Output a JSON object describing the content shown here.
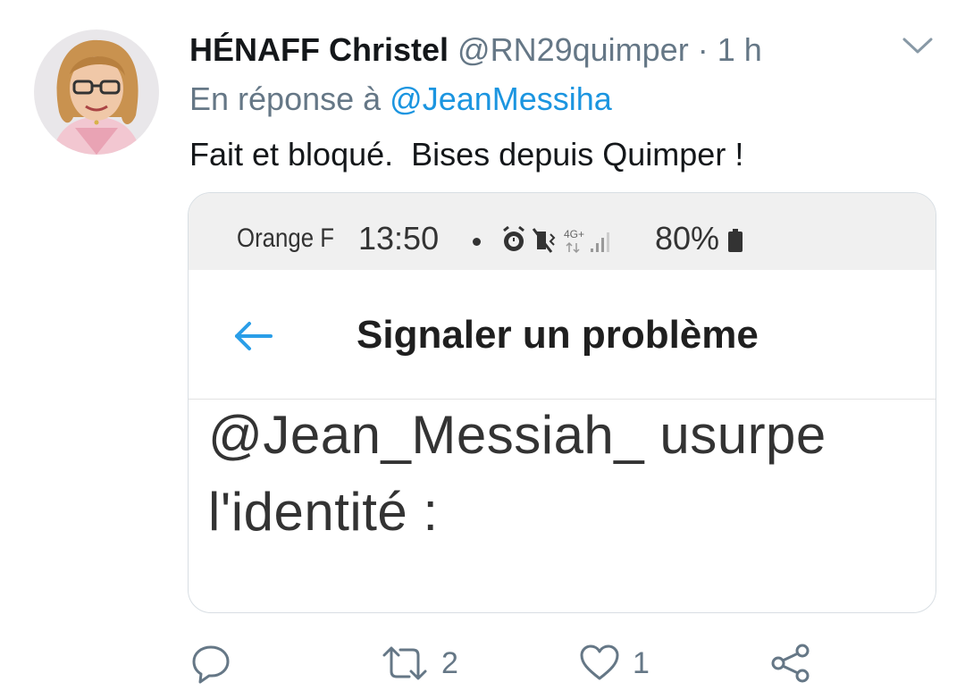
{
  "tweet": {
    "author_name": "HÉNAFF Christel",
    "handle": "@RN29quimper",
    "separator": "·",
    "time": "1 h",
    "reply_prefix": "En réponse à",
    "reply_to": "@JeanMessiha",
    "text": "Fait et bloqué.  Bises depuis Quimper !"
  },
  "embedded_screenshot": {
    "carrier": "Orange F",
    "clock": "13:50",
    "network": "4G+",
    "battery": "80%",
    "title": "Signaler un problème",
    "report_line1": "@Jean_Messiah_ usurpe",
    "report_line2": "l'identité :"
  },
  "actions": {
    "reply_icon": "speech-bubble-icon",
    "retweet_icon": "retweet-icon",
    "retweet_count": "2",
    "like_icon": "heart-icon",
    "like_count": "1",
    "share_icon": "share-icon"
  },
  "colors": {
    "accent": "#1b95e0",
    "muted": "#657786",
    "text": "#14171a",
    "status_bar": "#f0f0f0"
  }
}
